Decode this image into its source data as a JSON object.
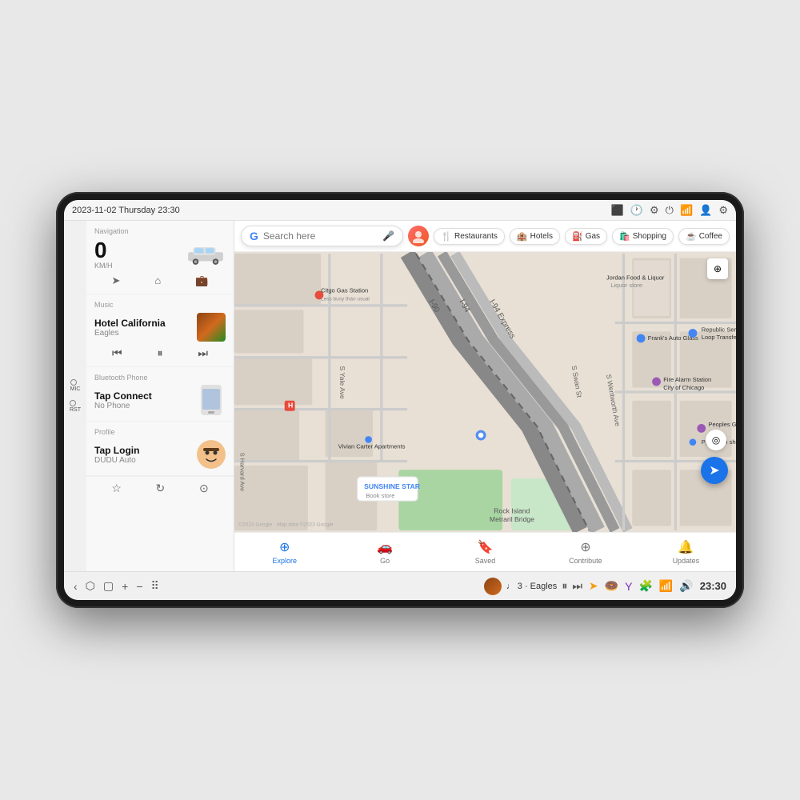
{
  "device": {
    "status_bar": {
      "datetime": "2023-11-02 Thursday 23:30",
      "icons": [
        "display-icon",
        "timer-icon",
        "settings-circle-icon",
        "power-icon",
        "wifi-icon",
        "user-icon",
        "gear-icon"
      ]
    },
    "side_buttons": [
      {
        "label": "MIC",
        "id": "mic-btn"
      },
      {
        "label": "RST",
        "id": "rst-btn"
      }
    ]
  },
  "left_panel": {
    "navigation": {
      "label": "Navigation",
      "speed": "0",
      "unit": "KM/H",
      "controls": [
        "navigate-icon",
        "home-icon",
        "briefcase-icon"
      ]
    },
    "music": {
      "label": "Music",
      "title": "Hotel California",
      "artist": "Eagles",
      "controls": [
        "prev-icon",
        "pause-icon",
        "next-icon"
      ]
    },
    "bluetooth": {
      "label": "Bluetooth Phone",
      "title": "Tap Connect",
      "status": "No Phone"
    },
    "profile": {
      "label": "Profile",
      "name": "Tap Login",
      "sub": "DUDU Auto"
    },
    "bottom_icons": [
      "star-icon",
      "refresh-icon",
      "settings-icon"
    ]
  },
  "map": {
    "search_placeholder": "Search here",
    "filter_chips": [
      {
        "icon": "🍴",
        "label": "Restaurants"
      },
      {
        "icon": "🏨",
        "label": "Hotels"
      },
      {
        "icon": "⛽",
        "label": "Gas"
      },
      {
        "icon": "🛍️",
        "label": "Shopping"
      },
      {
        "icon": "☕",
        "label": "Coffee"
      }
    ],
    "bottom_nav": [
      {
        "icon": "explore",
        "label": "Explore",
        "active": true
      },
      {
        "icon": "go",
        "label": "Go",
        "active": false
      },
      {
        "icon": "saved",
        "label": "Saved",
        "active": false
      },
      {
        "icon": "contribute",
        "label": "Contribute",
        "active": false
      },
      {
        "icon": "updates",
        "label": "Updates",
        "active": false
      }
    ],
    "copyright": "©2023 Google · Map data ©2023 Google"
  },
  "taskbar": {
    "left_buttons": [
      "back-icon",
      "home-icon",
      "square-icon",
      "plus-icon",
      "minus-icon",
      "apps-icon"
    ],
    "music_track": "♩  3 · Eagles",
    "music_controls": [
      "play-pause-icon",
      "next-icon"
    ],
    "right_icons": [
      "location-arrow-icon",
      "donut-icon",
      "yahoo-icon",
      "puzzle-icon",
      "wifi-icon",
      "volume-icon"
    ],
    "time": "23:30"
  }
}
